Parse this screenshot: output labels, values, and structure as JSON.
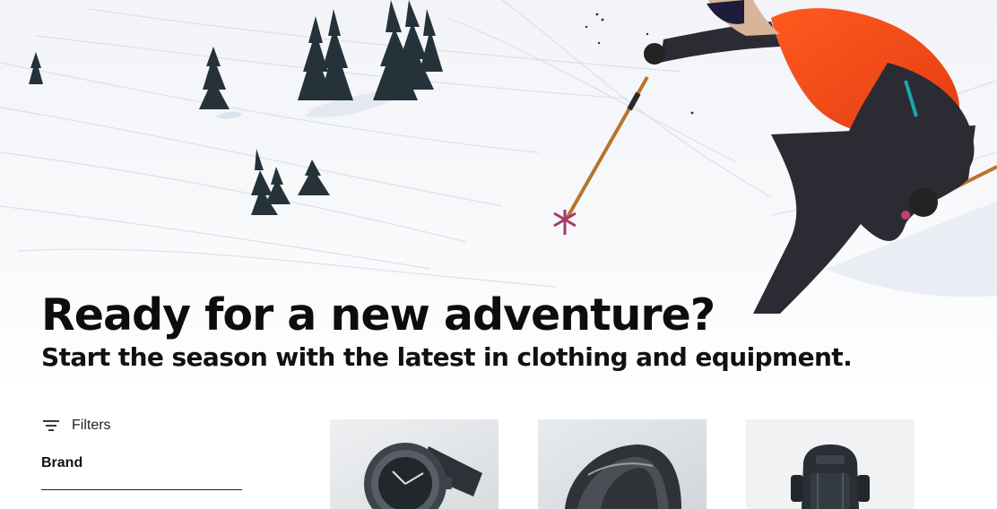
{
  "hero": {
    "headline": "Ready for a new adventure?",
    "subheadline": "Start the season with the latest in clothing and equipment."
  },
  "filters": {
    "icon": "filter-lines-icon",
    "label": "Filters"
  },
  "filter_groups": [
    {
      "label": "Brand"
    }
  ],
  "products": [
    {
      "icon": "watch-image"
    },
    {
      "icon": "helmet-image"
    },
    {
      "icon": "backpack-image"
    }
  ]
}
